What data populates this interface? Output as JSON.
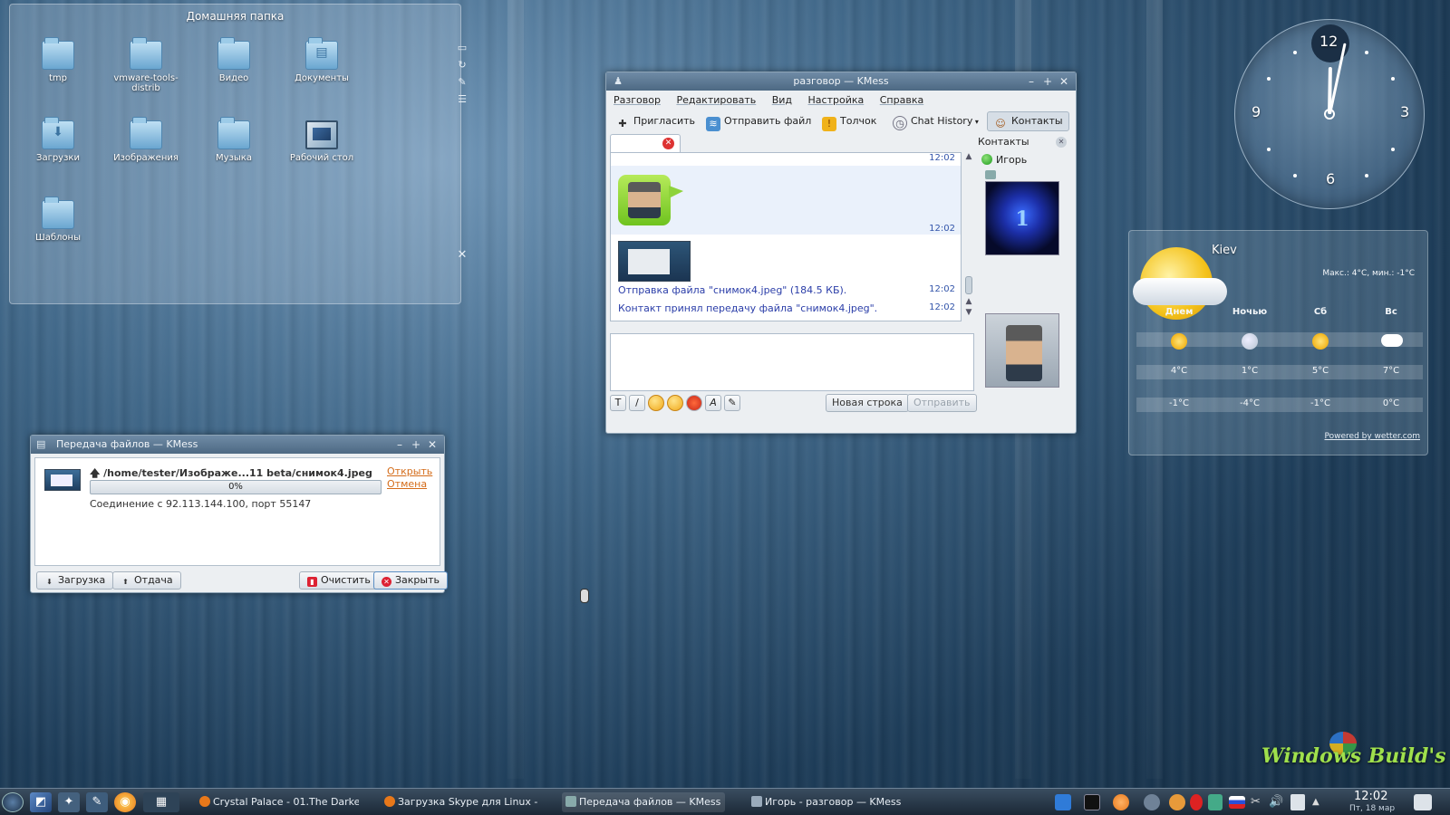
{
  "folder_view": {
    "title": "Домашняя папка",
    "icons": [
      {
        "label": "tmp",
        "type": "folder"
      },
      {
        "label": "vmware-tools-distrib",
        "type": "folder"
      },
      {
        "label": "Видео",
        "type": "folder"
      },
      {
        "label": "Документы",
        "type": "folder"
      },
      {
        "label": "Загрузки",
        "type": "folder"
      },
      {
        "label": "Изображения",
        "type": "folder"
      },
      {
        "label": "Музыка",
        "type": "folder"
      },
      {
        "label": "Рабочий стол",
        "type": "desktop"
      },
      {
        "label": "Шаблоны",
        "type": "folder"
      }
    ]
  },
  "chat_window": {
    "title": "разговор — KMess",
    "menu": [
      "Разговор",
      "Редактировать",
      "Вид",
      "Настройка",
      "Справка"
    ],
    "toolbar": {
      "invite": "Пригласить",
      "send_file": "Отправить файл",
      "nudge": "Толчок",
      "chat_history": "Chat History",
      "contacts": "Контакты"
    },
    "messages": {
      "time_1": "12:02",
      "time_2": "12:02",
      "time_3": "12:02",
      "time_4": "12:02",
      "file_send": "Отправка файла \"снимок4.jpeg\" (184.5 КБ).",
      "file_accepted": "Контакт принял передачу файла \"снимок4.jpeg\"."
    },
    "buttons": {
      "new_line": "Новая строка",
      "send": "Отправить"
    },
    "contacts_panel": {
      "header": "Контакты",
      "contact_name": "Игорь"
    }
  },
  "transfer_window": {
    "title": "Передача файлов — KMess",
    "file_path": "/home/tester/Изображе...11 beta/снимок4.jpeg",
    "progress": 0,
    "progress_label": "0%",
    "open_link": "Открыть",
    "cancel_link": "Отмена",
    "connection": "Соединение с 92.113.144.100, порт 55147",
    "btn_download": "Загрузка",
    "btn_upload": "Отдача",
    "btn_clear": "Очистить",
    "btn_close": "Закрыть"
  },
  "clock": {
    "numbers": [
      "12",
      "3",
      "6",
      "9"
    ],
    "time_hours": 12,
    "time_minutes": 2
  },
  "weather": {
    "city": "Kiev",
    "range": "Макс.: 4°C, мин.: -1°C",
    "days": [
      "Днем",
      "Ночью",
      "Сб",
      "Вс"
    ],
    "icons": [
      "sunny",
      "moon",
      "sunny",
      "snow"
    ],
    "high": [
      "4°C",
      "1°C",
      "5°C",
      "7°C"
    ],
    "low": [
      "-1°C",
      "-4°C",
      "-1°C",
      "0°C"
    ],
    "powered": "Powered by wetter.com"
  },
  "watermark": "Windows Build's",
  "taskbar": {
    "tasks": [
      "Crystal Palace - 01.The Darke",
      "Загрузка Skype для Linux - M",
      "Передача файлов — KMess",
      "Игорь - разговор — KMess"
    ],
    "time": "12:02",
    "date": "Пт, 18 мар"
  },
  "colors": {
    "accent_link": "#d46c1a",
    "chat_text": "#2a3da8",
    "online": "#1d9a1d"
  }
}
